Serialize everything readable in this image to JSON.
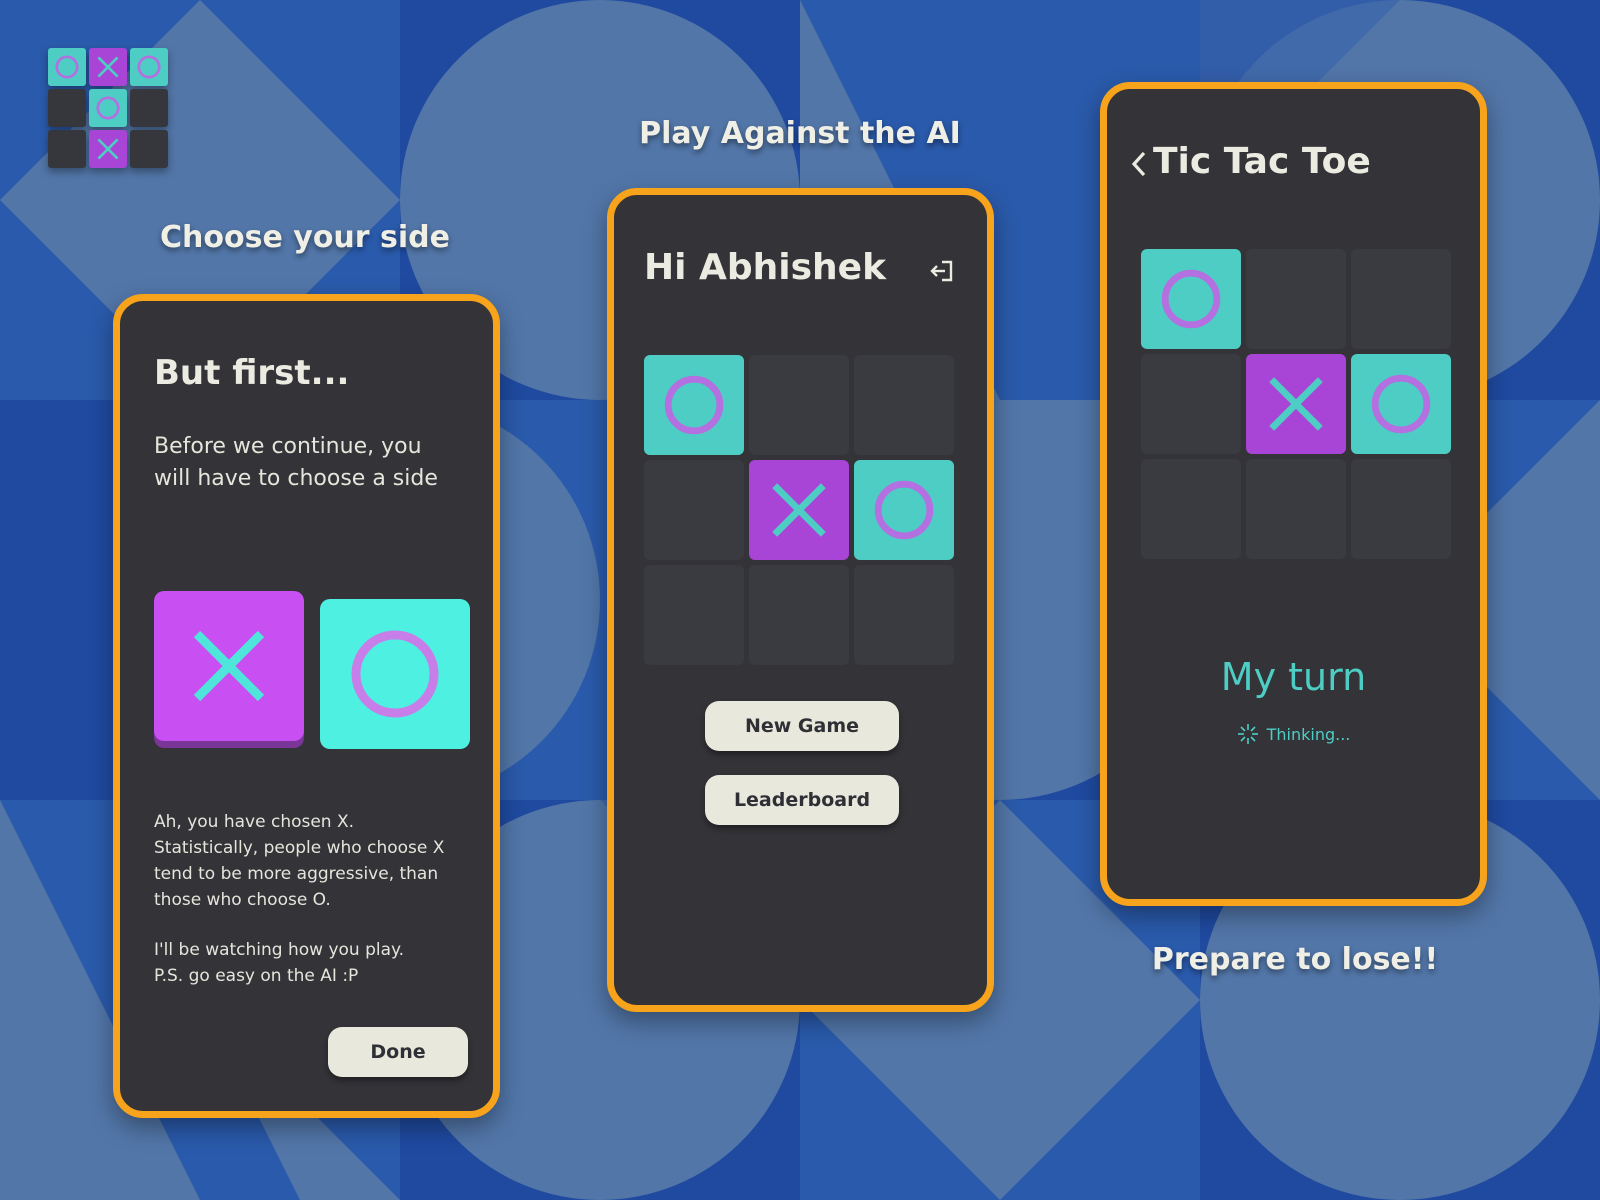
{
  "colors": {
    "background": "#1f4aa0",
    "phone_frame": "#f7a31b",
    "phone_body": "#333338",
    "x_tile": "#a845d6",
    "o_tile": "#4ecdc4",
    "accent_text": "#4ecdc4"
  },
  "logo": {
    "cells": [
      "o",
      "x",
      "o",
      "",
      "o",
      "",
      "",
      "x",
      ""
    ]
  },
  "captions": {
    "choose_side": "Choose your side",
    "play_ai": "Play Against the AI",
    "prepare": "Prepare to lose!!"
  },
  "screen1": {
    "title": "But first...",
    "intro": "Before we continue, you\nwill have to choose a side",
    "option_x": "x-icon",
    "option_o": "o-icon",
    "selected": "x",
    "message": "Ah, you have chosen X.\nStatistically, people who choose X\ntend to be more aggressive, than\nthose who choose O.",
    "message2": "I'll be watching how you play.\nP.S. go easy on the AI :P",
    "done_label": "Done"
  },
  "screen2": {
    "greeting": "Hi Abhishek",
    "logout_icon": "logout-icon",
    "board": [
      "o",
      "",
      "",
      "",
      "x",
      "o",
      "",
      "",
      ""
    ],
    "new_game_label": "New Game",
    "leaderboard_label": "Leaderboard"
  },
  "screen3": {
    "back_icon": "chevron-left-icon",
    "title": "Tic Tac Toe",
    "board": [
      "o",
      "",
      "",
      "",
      "x",
      "o",
      "",
      "",
      ""
    ],
    "status": "My turn",
    "thinking": "Thinking..."
  }
}
